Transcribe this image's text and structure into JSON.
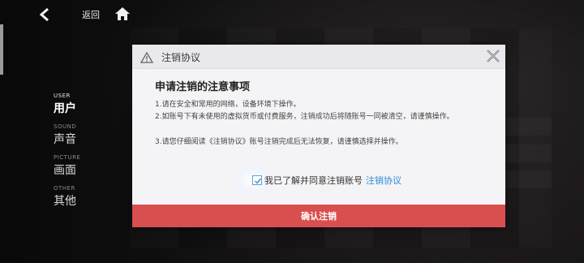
{
  "nav": {
    "back_label": "返回",
    "back_icon": "back-arrow-icon",
    "home_icon": "home-icon"
  },
  "sidebar": {
    "items": [
      {
        "en": "USER",
        "zh": "用户",
        "active": true
      },
      {
        "en": "SOUND",
        "zh": "声音",
        "active": false
      },
      {
        "en": "PICTURE",
        "zh": "画面",
        "active": false
      },
      {
        "en": "OTHER",
        "zh": "其他",
        "active": false
      }
    ]
  },
  "dialog": {
    "title": "注销协议",
    "heading": "申请注销的注意事项",
    "notices": [
      "1.请在安全和常用的网络，设备环境下操作。",
      "2.如账号下有未使用的虚拟货币或付费服务，注销成功后将随账号一同被清空，请谨慎操作。",
      "3.请您仔细阅读《注销协议》账号注销完成后无法恢复，请谨慎选择并操作。"
    ],
    "agree_text": "我已了解并同意注销账号",
    "agree_link": "注销协议",
    "agree_checked": true,
    "confirm_label": "确认注销"
  },
  "colors": {
    "accent_red": "#d94f4f",
    "link_blue": "#2c8ad8",
    "dialog_bg": "#f4f4f6"
  }
}
